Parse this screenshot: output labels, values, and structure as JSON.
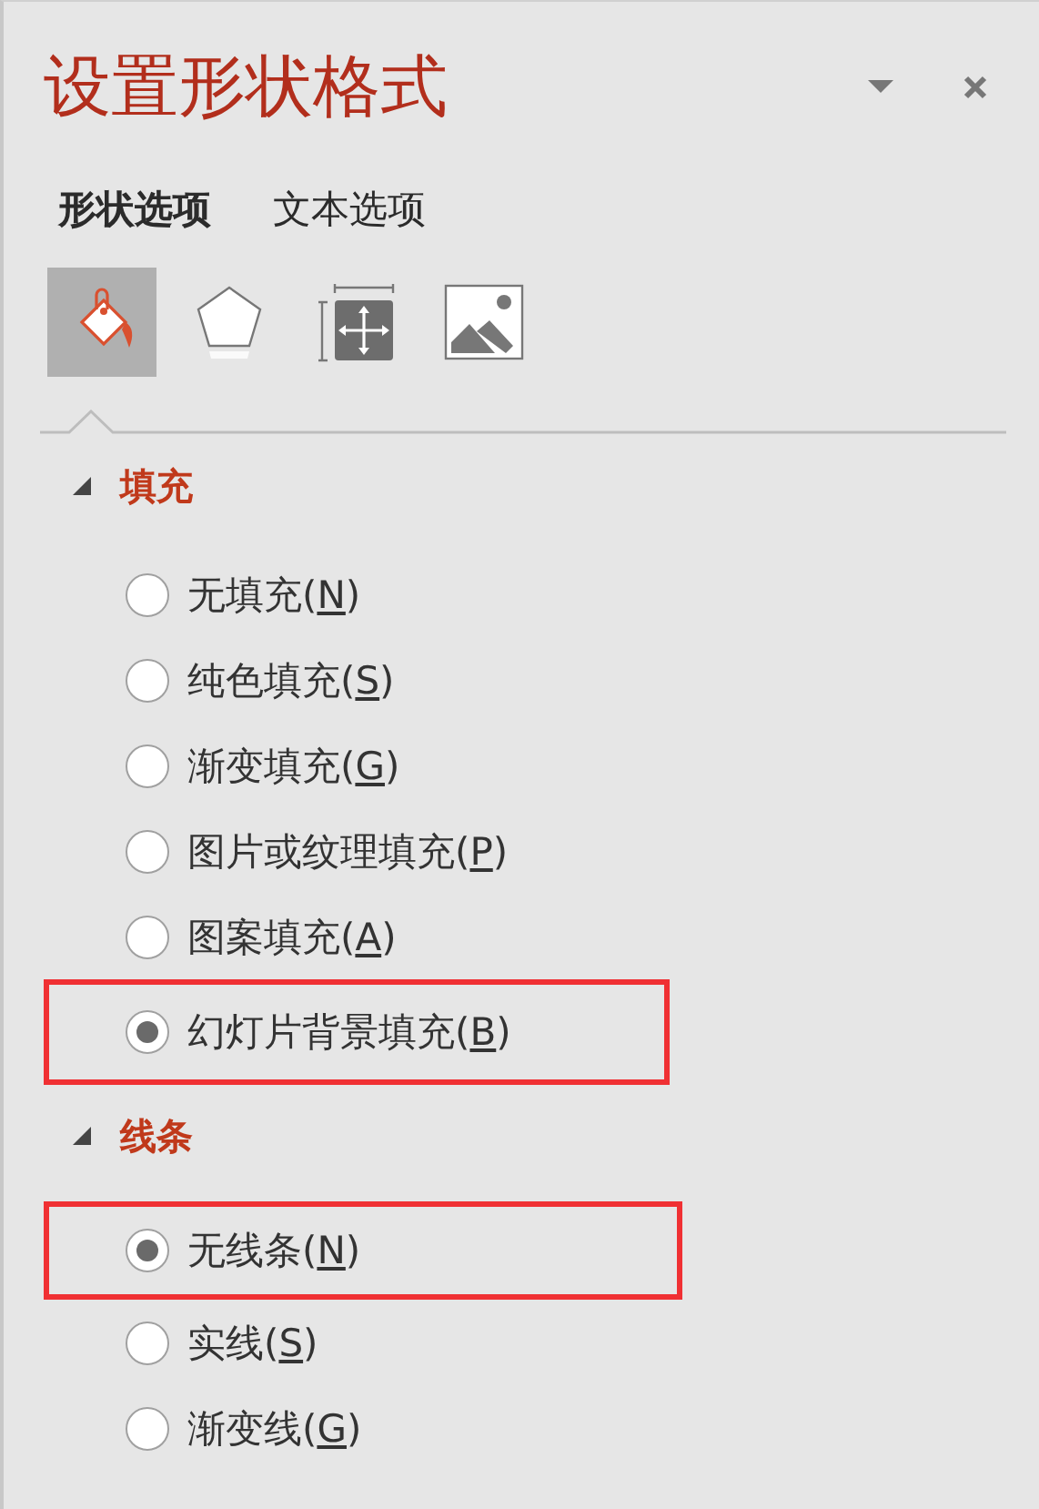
{
  "panel": {
    "title": "设置形状格式"
  },
  "tabs": [
    {
      "label": "形状选项",
      "selected": true
    },
    {
      "label": "文本选项",
      "selected": false
    }
  ],
  "icon_tabs": [
    {
      "kind": "fill",
      "selected": true
    },
    {
      "kind": "effects",
      "selected": false
    },
    {
      "kind": "size",
      "selected": false
    },
    {
      "kind": "picture",
      "selected": false
    }
  ],
  "sections": [
    {
      "title": "填充",
      "expanded": true,
      "options": [
        {
          "label": "无填充(N)",
          "selected": false,
          "highlighted": false
        },
        {
          "label": "纯色填充(S)",
          "selected": false,
          "highlighted": false
        },
        {
          "label": "渐变填充(G)",
          "selected": false,
          "highlighted": false
        },
        {
          "label": "图片或纹理填充(P)",
          "selected": false,
          "highlighted": false
        },
        {
          "label": "图案填充(A)",
          "selected": false,
          "highlighted": false
        },
        {
          "label": "幻灯片背景填充(B)",
          "selected": true,
          "highlighted": true
        }
      ]
    },
    {
      "title": "线条",
      "expanded": true,
      "options": [
        {
          "label": "无线条(N)",
          "selected": true,
          "highlighted": true
        },
        {
          "label": "实线(S)",
          "selected": false,
          "highlighted": false
        },
        {
          "label": "渐变线(G)",
          "selected": false,
          "highlighted": false
        }
      ]
    }
  ]
}
